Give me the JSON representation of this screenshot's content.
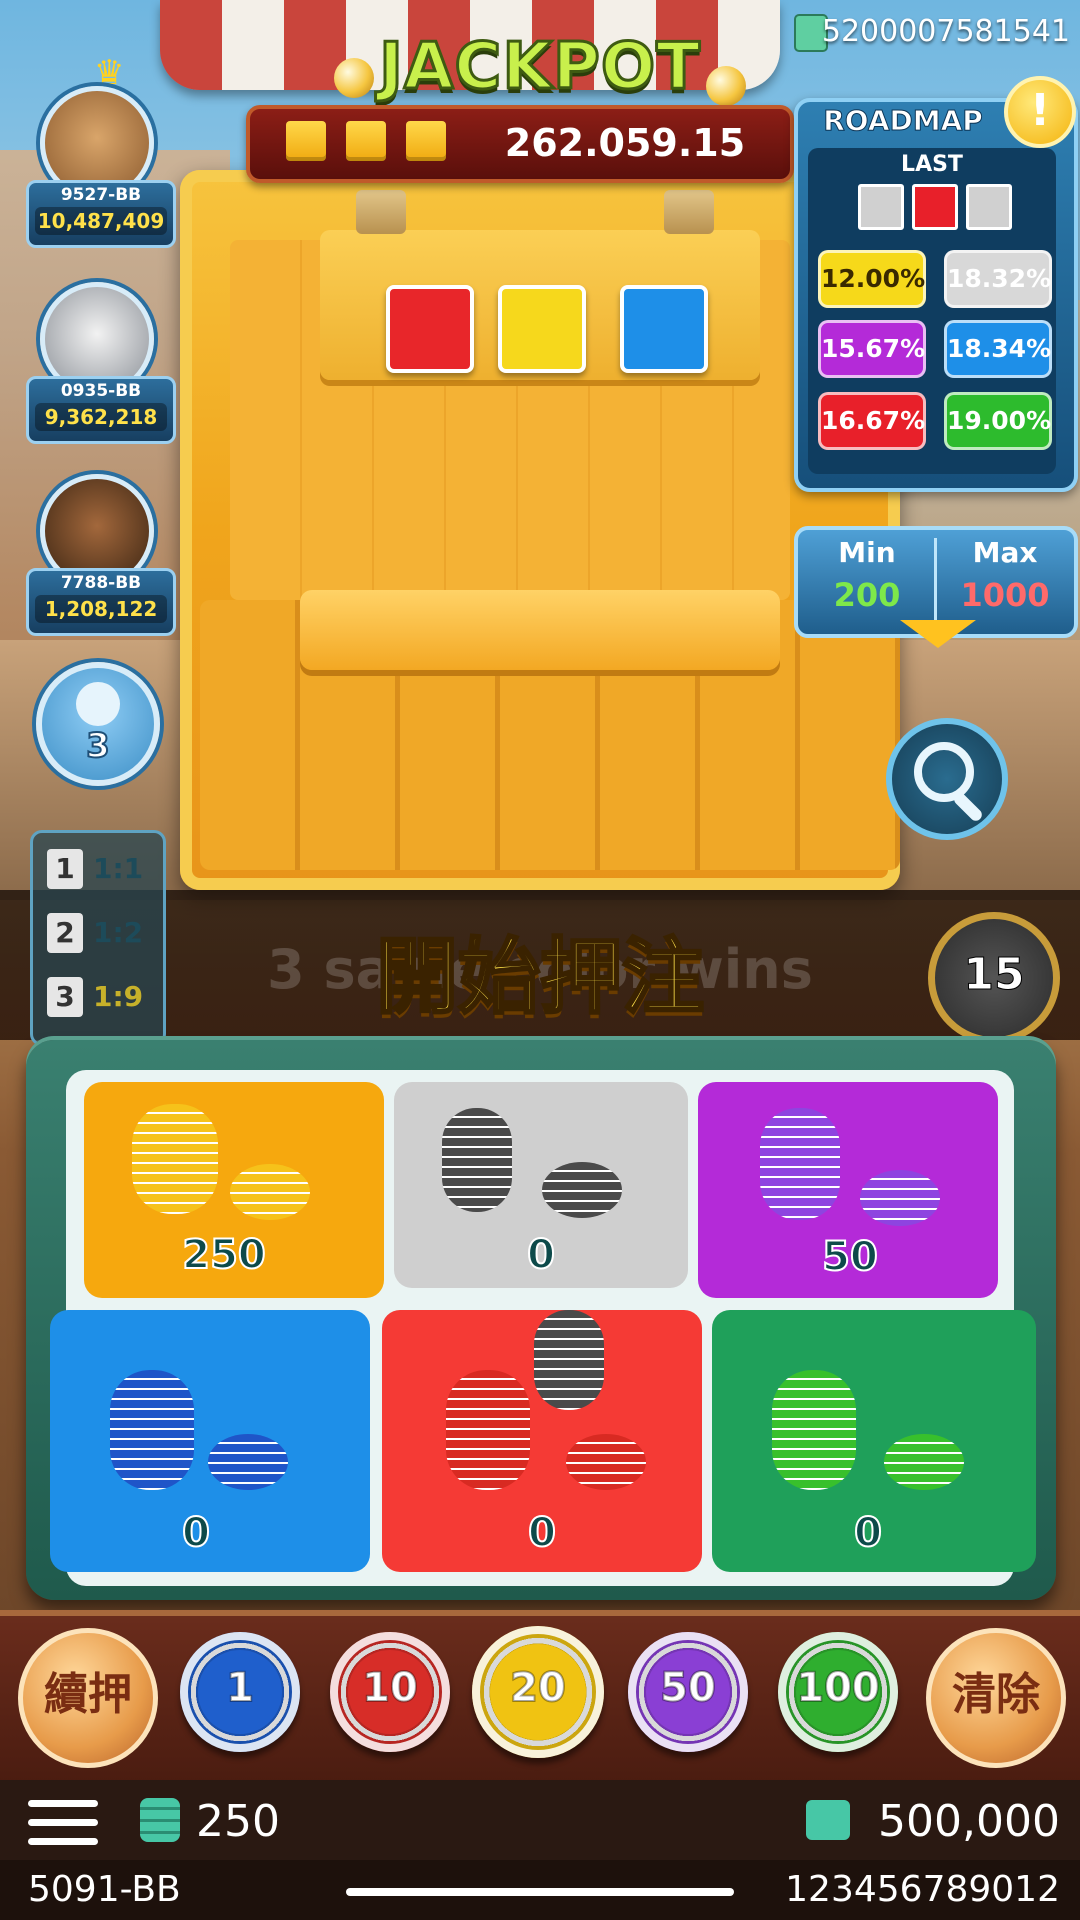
{
  "header": {
    "account_id": "5200007581541",
    "jackpot_title": "JACKPOT",
    "jackpot_value": "262.059.15"
  },
  "players": [
    {
      "id": "9527-BB",
      "balance": "10,487,409",
      "crowned": true
    },
    {
      "id": "0935-BB",
      "balance": "9,362,218"
    },
    {
      "id": "7788-BB",
      "balance": "1,208,122"
    }
  ],
  "online_count": "3",
  "roadmap": {
    "title": "ROADMAP",
    "alert_symbol": "!",
    "last_label": "LAST",
    "last": [
      {
        "color": "#d0d0d0"
      },
      {
        "color": "#e8202a"
      },
      {
        "color": "#d0d0d0"
      }
    ],
    "stats": [
      {
        "value": "12.00%",
        "color": "#f6d91a",
        "text_color": "#3a2a00"
      },
      {
        "value": "18.32%",
        "color": "#d8d8d8",
        "text_color": "#ffffff"
      },
      {
        "value": "15.67%",
        "color": "#b42ad8",
        "text_color": "#ffffff"
      },
      {
        "value": "18.34%",
        "color": "#1e8fe8",
        "text_color": "#ffffff"
      },
      {
        "value": "16.67%",
        "color": "#e8202a",
        "text_color": "#ffffff"
      },
      {
        "value": "19.00%",
        "color": "#2dbb2d",
        "text_color": "#ffffff"
      }
    ]
  },
  "limits": {
    "min_label": "Min",
    "min_value": "200",
    "max_label": "Max",
    "max_value": "1000",
    "min_color": "#7ee84a",
    "max_color": "#ff6a6a"
  },
  "dice": [
    {
      "color": "#e8262a"
    },
    {
      "color": "#f6d81c"
    },
    {
      "color": "#1e8fe8"
    }
  ],
  "odds": [
    {
      "num": "1",
      "ratio": "1:1",
      "color": "#1d4b5a"
    },
    {
      "num": "2",
      "ratio": "1:2",
      "color": "#1d4b5a"
    },
    {
      "num": "3",
      "ratio": "1:9",
      "color": "#c7b12a"
    }
  ],
  "banner": {
    "text": "開始押注",
    "background_text": "3 same color wins"
  },
  "timer": "15",
  "bet_cells": [
    {
      "color": "#f6a80e",
      "amount": "250",
      "chip": "#f6c21a"
    },
    {
      "color": "#cfcfcf",
      "amount": "0",
      "chip": "#4a4a4a"
    },
    {
      "color": "#b42ad8",
      "amount": "50",
      "chip": "#8e44e0"
    },
    {
      "color": "#1e8fe8",
      "amount": "0",
      "chip": "#1f55c8"
    },
    {
      "color": "#f53a35",
      "amount": "0",
      "chip": "#d82a22"
    },
    {
      "color": "#1fa05a",
      "amount": "0",
      "chip": "#38c02c"
    }
  ],
  "controls": {
    "rebet_label": "續押",
    "clear_label": "清除",
    "chips": [
      {
        "value": "1",
        "color": "#1f5fcc"
      },
      {
        "value": "10",
        "color": "#d72d28"
      },
      {
        "value": "20",
        "color": "#f0c312"
      },
      {
        "value": "50",
        "color": "#8a3fd4"
      },
      {
        "value": "100",
        "color": "#2fae2f"
      }
    ]
  },
  "footer": {
    "bet_total": "250",
    "balance": "500,000",
    "user_id": "5091-BB",
    "game_no": "123456789012"
  }
}
